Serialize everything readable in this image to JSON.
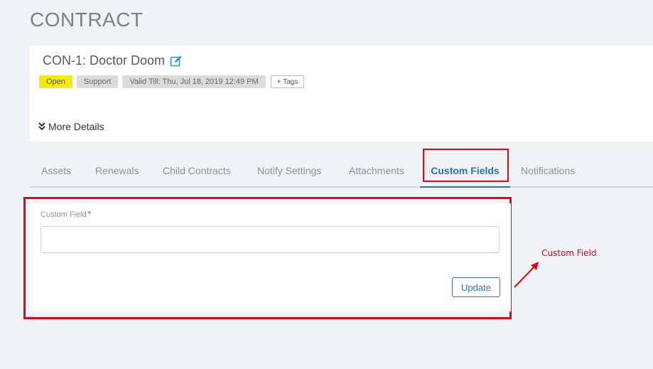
{
  "page": {
    "title": "CONTRACT"
  },
  "contract": {
    "name": "CON-1: Doctor Doom",
    "badges": {
      "status": "Open",
      "type": "Support",
      "validity": "Valid Till: Thu, Jul 18, 2019 12:49 PM",
      "tags": "+ Tags"
    },
    "more_details": "More Details"
  },
  "tabs": [
    {
      "label": "Assets"
    },
    {
      "label": "Renewals"
    },
    {
      "label": "Child Contracts"
    },
    {
      "label": "Notify Settings"
    },
    {
      "label": "Attachments"
    },
    {
      "label": "Custom Fields",
      "active": true
    },
    {
      "label": "Notifications"
    }
  ],
  "form": {
    "field_label": "Custom Field",
    "required_marker": "*",
    "field_value": "",
    "update_label": "Update"
  },
  "annotation": {
    "label": "Custom Field"
  },
  "colors": {
    "accent": "#2f6fb5",
    "highlight": "#e30613",
    "status_open": "#f8e80c",
    "background": "#f0f3f6"
  },
  "icons": [
    "edit-icon",
    "double-chevron-down-icon"
  ]
}
